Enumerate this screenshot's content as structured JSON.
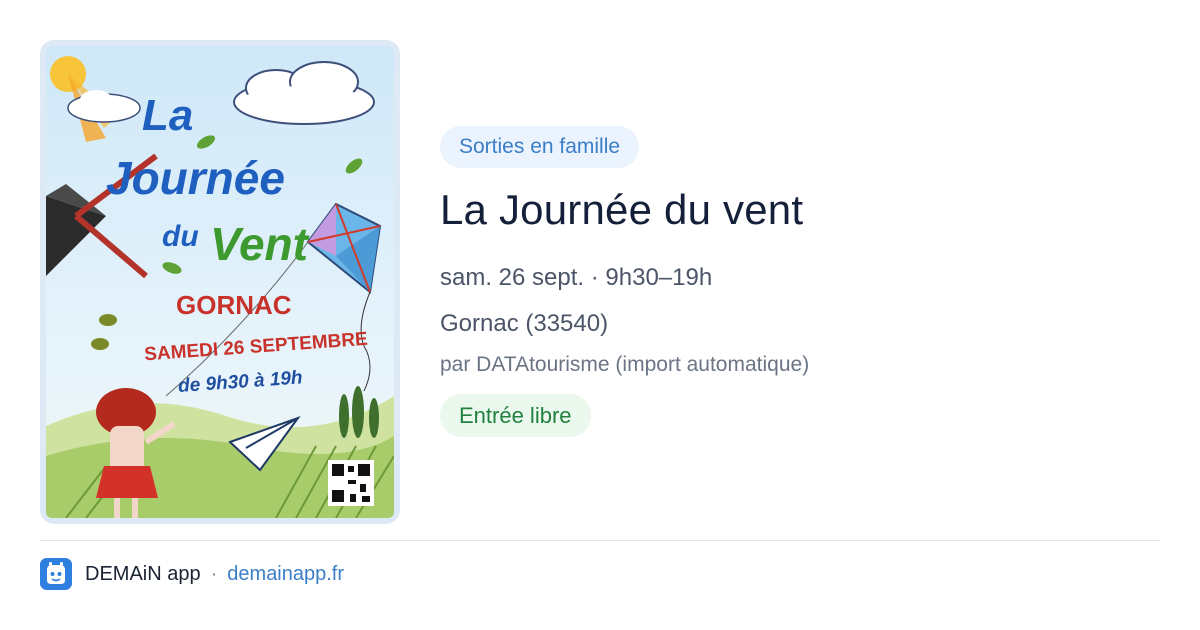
{
  "poster": {
    "line1": "La",
    "line2": "Journée",
    "line3": "du",
    "line4": "Vent",
    "town": "GORNAC",
    "date": "SAMEDI 26 SEPTEMBRE",
    "hours": "de 9h30 à 19h"
  },
  "event": {
    "category": "Sorties en famille",
    "title": "La Journée du vent",
    "when": "sam. 26 sept. · 9h30–19h",
    "where": "Gornac (33540)",
    "source": "par DATAtourisme (import automatique)",
    "price": "Entrée libre"
  },
  "footer": {
    "app_name": "DEMAiN app",
    "separator": "·",
    "site": "demainapp.fr"
  },
  "colors": {
    "accent": "#3b7ec7",
    "category_bg": "#eaf3fe",
    "price_text": "#22813f",
    "price_bg": "#ebf8ee",
    "title": "#14203a"
  },
  "icons": {
    "app_logo": "demain-app-icon"
  }
}
